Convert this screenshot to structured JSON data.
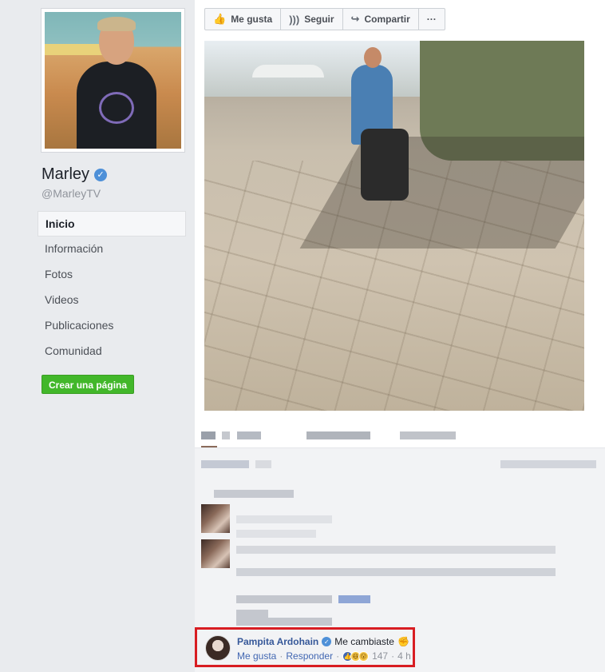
{
  "page": {
    "name": "Marley",
    "handle": "@MarleyTV"
  },
  "nav": {
    "items": [
      {
        "label": "Inicio"
      },
      {
        "label": "Información"
      },
      {
        "label": "Fotos"
      },
      {
        "label": "Videos"
      },
      {
        "label": "Publicaciones"
      },
      {
        "label": "Comunidad"
      }
    ],
    "create_page_label": "Crear una página"
  },
  "toolbar": {
    "like_label": "Me gusta",
    "follow_label": "Seguir",
    "share_label": "Compartir",
    "more_label": "···"
  },
  "icons": {
    "like": "thumbs-up-icon",
    "follow": "rss-icon",
    "share": "share-arrow-icon",
    "verified": "verified-check-icon"
  },
  "highlighted_comment": {
    "author": "Pampita Ardohain",
    "text": "Me cambiaste",
    "emoji": "✊",
    "like_link": "Me gusta",
    "reply_link": "Responder",
    "separator": "·",
    "reaction_count": "147",
    "time": "4 h"
  },
  "colors": {
    "accent_link": "#365899",
    "create_button": "#42b72a",
    "highlight_border": "#d81d22",
    "verified_badge": "#4e90d8"
  }
}
